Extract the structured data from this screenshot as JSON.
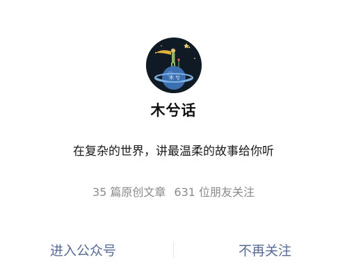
{
  "profile": {
    "name": "木兮话",
    "slogan": "在复杂的世界，讲最温柔的故事给你听",
    "avatar_text": "木兮"
  },
  "stats": {
    "articles": "35 篇原创文章",
    "followers": "631 位朋友关注"
  },
  "actions": {
    "enter_label": "进入公众号",
    "unfollow_label": "不再关注"
  },
  "colors": {
    "link": "#576b95",
    "muted": "#8a8a8a",
    "avatar_bg": "#0f1a24"
  },
  "icons": {
    "avatar": "little-prince-planet-icon"
  }
}
